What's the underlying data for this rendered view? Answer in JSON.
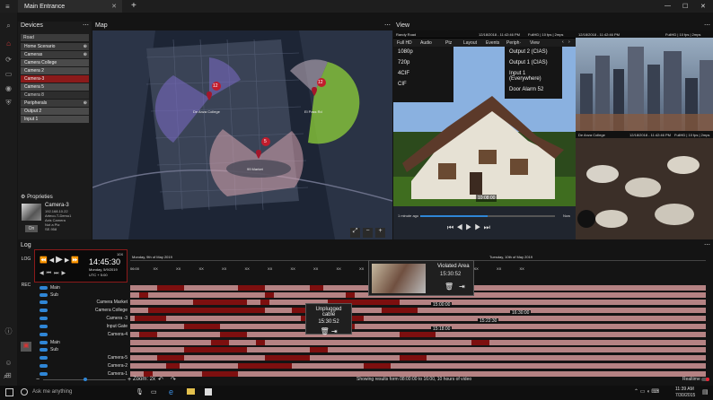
{
  "window": {
    "tab_title": "Main Entrance",
    "new_tab": "+",
    "controls": [
      "—",
      "☐",
      "✕"
    ]
  },
  "devices": {
    "title": "Devices",
    "search_placeholder": "Road",
    "items": [
      {
        "label": "Home Scenario",
        "style": "group"
      },
      {
        "label": "Cameras",
        "style": "group"
      },
      {
        "label": "Camera College",
        "style": "item"
      },
      {
        "label": "Camera 2",
        "style": "item"
      },
      {
        "label": "Camera-3",
        "style": "sel"
      },
      {
        "label": "Camera 5",
        "style": "item"
      },
      {
        "label": "Camera 8",
        "style": "dark"
      },
      {
        "label": "Peripherals",
        "style": "group"
      },
      {
        "label": "Output 2",
        "style": "item"
      },
      {
        "label": "Input 1",
        "style": "item"
      }
    ]
  },
  "properties": {
    "title": "Proprieties",
    "camera": "Camera-3",
    "details": [
      "192.168.10.22",
      "Arteco-T-Demo1",
      "Axis Camera",
      "Not a Ptz",
      "SE.958"
    ],
    "on_button": "On"
  },
  "map": {
    "title": "Map",
    "pins": [
      {
        "n": "12",
        "label": "De Anza College"
      },
      {
        "n": "12",
        "label": "El Pass Rd"
      },
      {
        "n": "5",
        "label": "99 Market"
      }
    ]
  },
  "view": {
    "title": "View",
    "top_left": "Randy Road",
    "top_left_meta": "12/18/2018 - 11:42:46 PM",
    "top_left_info": "FullHD | 10 fps | 2mps",
    "top_right_meta": "12/18/2018 - 11:42:46 PM",
    "top_right_info": "FullHD | 10 fps | 2mps",
    "toolbar": [
      "Full HD",
      "Audio",
      "Ptz",
      "Layout",
      "Events",
      "Periph·",
      "View"
    ],
    "res_options": [
      "1080p",
      "720p",
      "4CIF",
      "CIF"
    ],
    "periph_options": [
      "Output 2 (CIAS)",
      "Output 1 (CIAS)",
      "Input 1 (Everywhere)",
      "Door Alarm 52"
    ],
    "house_time": "10:08:00",
    "range_start": "1 minute ago",
    "range_end": "Now",
    "bottom_left_label": "De Anza College",
    "bottom_right_meta": "12/18/2018 - 11:42:46 PM",
    "bottom_right_info": "FullHD | 10 fps | 2mps"
  },
  "log": {
    "title": "Log",
    "side_tabs": [
      "LOG",
      "REC"
    ],
    "player": {
      "time": "14:45:30",
      "date": "Monday, 5/9/2019",
      "utc": "UTC + 5:00",
      "speed": "10X"
    },
    "days": [
      "Monday, 9th of May 2019",
      "Tuesday, 10th of May 2019"
    ],
    "ticks": [
      "06:00",
      "XX",
      "XX",
      "XX",
      "XX",
      "XX",
      "XX",
      "XX",
      "XX",
      "XX",
      "XX",
      "XX",
      "XX",
      "XX",
      "XX",
      "XX",
      "XX",
      "XX"
    ],
    "rows": [
      {
        "label": "Main",
        "toggle": true
      },
      {
        "label": "Sub",
        "toggle": true
      },
      {
        "label": "Camera Market",
        "toggle": true
      },
      {
        "label": "Camera College",
        "toggle": true
      },
      {
        "label": "Camera -3",
        "toggle": true
      },
      {
        "label": "Input Gate",
        "toggle": true
      },
      {
        "label": "Camera-4",
        "toggle": true
      },
      {
        "label": "Main",
        "toggle": true
      },
      {
        "label": "Sub",
        "toggle": true
      },
      {
        "label": "Camera-5",
        "toggle": true
      },
      {
        "label": "Camera-2",
        "toggle": true
      },
      {
        "label": "Camera-1",
        "toggle": true
      }
    ],
    "markers": [
      "15:00:00",
      "16:30:00",
      "15:22:30",
      "15:18:00"
    ],
    "tooltip_violated": {
      "title": "Violated Area",
      "time": "15:30:52"
    },
    "tooltip_cable": {
      "title": "Unplugged cable",
      "time": "15:30:52"
    },
    "zoom": "Zoom: 2x",
    "status": "Showing results form 08:00:00 to 16:00, 10 hours of video",
    "realtime": "Realtime"
  },
  "taskbar": {
    "search": "Ask me anything",
    "time": "11:39 AM",
    "date": "7/30/2015"
  }
}
